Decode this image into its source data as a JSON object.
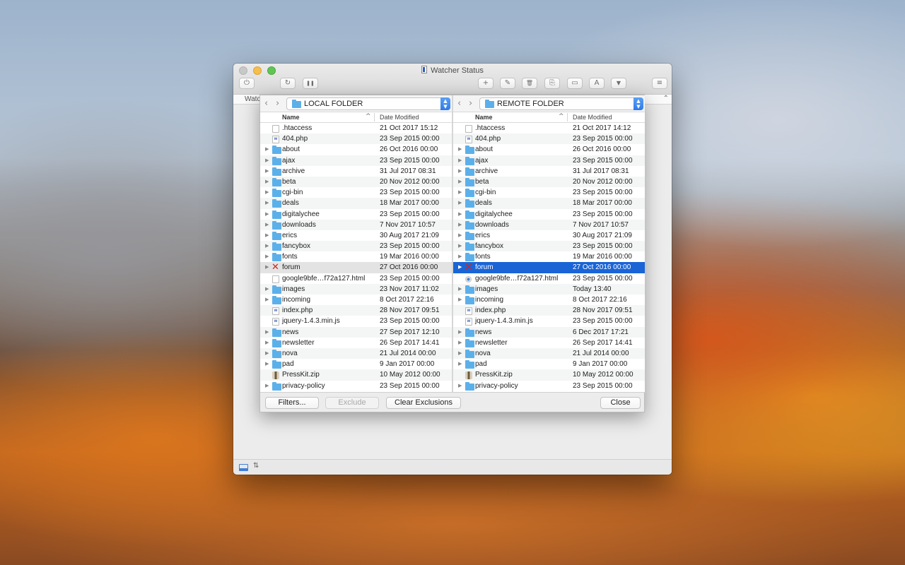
{
  "window": {
    "title": "Watcher Status",
    "tab_peek": "Watc"
  },
  "toolbar": {
    "power_glyph": "⏻",
    "refresh_glyph": "↻",
    "pause_glyph": "❚❚",
    "new_file_glyph": "+",
    "edit_glyph": "✎",
    "trash_glyph": "🗑",
    "copy_glyph": "⎘",
    "folder_glyph": "▭",
    "rename_glyph": "A",
    "filter_glyph": "▼",
    "log_glyph": "≡"
  },
  "local": {
    "path": "LOCAL FOLDER",
    "col_name": "Name",
    "col_date": "Date Modified",
    "rows": [
      {
        "name": ".htaccess",
        "date": "21 Oct 2017 15:12",
        "icon": "file-icon",
        "tri": ""
      },
      {
        "name": "404.php",
        "date": "23 Sep 2015 00:00",
        "icon": "php-file-icon",
        "tri": ""
      },
      {
        "name": "about",
        "date": "26 Oct 2016 00:00",
        "icon": "folder-icon",
        "tri": "▶"
      },
      {
        "name": "ajax",
        "date": "23 Sep 2015 00:00",
        "icon": "folder-icon",
        "tri": "▶"
      },
      {
        "name": "archive",
        "date": "31 Jul 2017 08:31",
        "icon": "folder-icon",
        "tri": "▶"
      },
      {
        "name": "beta",
        "date": "20 Nov 2012 00:00",
        "icon": "folder-icon",
        "tri": "▶"
      },
      {
        "name": "cgi-bin",
        "date": "23 Sep 2015 00:00",
        "icon": "folder-icon",
        "tri": "▶"
      },
      {
        "name": "deals",
        "date": "18 Mar 2017 00:00",
        "icon": "folder-icon",
        "tri": "▶"
      },
      {
        "name": "digitalychee",
        "date": "23 Sep 2015 00:00",
        "icon": "folder-icon",
        "tri": "▶"
      },
      {
        "name": "downloads",
        "date": "7 Nov 2017 10:57",
        "icon": "folder-icon",
        "tri": "▶"
      },
      {
        "name": "erics",
        "date": "30 Aug 2017 21:09",
        "icon": "folder-icon",
        "tri": "▶"
      },
      {
        "name": "fancybox",
        "date": "23 Sep 2015 00:00",
        "icon": "folder-icon",
        "tri": "▶"
      },
      {
        "name": "fonts",
        "date": "19 Mar 2016 00:00",
        "icon": "folder-icon",
        "tri": "▶"
      },
      {
        "name": "forum",
        "date": "27 Oct 2016 00:00",
        "icon": "excluded-x-icon",
        "tri": "▶",
        "state": "dim"
      },
      {
        "name": "google9bfe…f72a127.html",
        "date": "23 Sep 2015 00:00",
        "icon": "file-icon",
        "tri": ""
      },
      {
        "name": "images",
        "date": "23 Nov 2017 11:02",
        "icon": "folder-icon",
        "tri": "▶"
      },
      {
        "name": "incoming",
        "date": "8 Oct 2017 22:16",
        "icon": "folder-icon",
        "tri": "▶"
      },
      {
        "name": "index.php",
        "date": "28 Nov 2017 09:51",
        "icon": "php-file-icon",
        "tri": ""
      },
      {
        "name": "jquery-1.4.3.min.js",
        "date": "23 Sep 2015 00:00",
        "icon": "php-file-icon",
        "tri": ""
      },
      {
        "name": "news",
        "date": "27 Sep 2017 12:10",
        "icon": "folder-icon",
        "tri": "▶"
      },
      {
        "name": "newsletter",
        "date": "26 Sep 2017 14:41",
        "icon": "folder-icon",
        "tri": "▶"
      },
      {
        "name": "nova",
        "date": "21 Jul 2014 00:00",
        "icon": "folder-icon",
        "tri": "▶"
      },
      {
        "name": "pad",
        "date": "9 Jan 2017 00:00",
        "icon": "folder-icon",
        "tri": "▶"
      },
      {
        "name": "PressKit.zip",
        "date": "10 May 2012 00:00",
        "icon": "zip-icon",
        "tri": ""
      },
      {
        "name": "privacy-policy",
        "date": "23 Sep 2015 00:00",
        "icon": "folder-icon",
        "tri": "▶"
      }
    ]
  },
  "remote": {
    "path": "REMOTE FOLDER",
    "col_name": "Name",
    "col_date": "Date Modified",
    "rows": [
      {
        "name": ".htaccess",
        "date": "21 Oct 2017 14:12",
        "icon": "file-icon",
        "tri": ""
      },
      {
        "name": "404.php",
        "date": "23 Sep 2015 00:00",
        "icon": "php-file-icon",
        "tri": ""
      },
      {
        "name": "about",
        "date": "26 Oct 2016 00:00",
        "icon": "folder-icon",
        "tri": "▶"
      },
      {
        "name": "ajax",
        "date": "23 Sep 2015 00:00",
        "icon": "folder-icon",
        "tri": "▶"
      },
      {
        "name": "archive",
        "date": "31 Jul 2017 08:31",
        "icon": "folder-icon",
        "tri": "▶"
      },
      {
        "name": "beta",
        "date": "20 Nov 2012 00:00",
        "icon": "folder-icon",
        "tri": "▶"
      },
      {
        "name": "cgi-bin",
        "date": "23 Sep 2015 00:00",
        "icon": "folder-icon",
        "tri": "▶"
      },
      {
        "name": "deals",
        "date": "18 Mar 2017 00:00",
        "icon": "folder-icon",
        "tri": "▶"
      },
      {
        "name": "digitalychee",
        "date": "23 Sep 2015 00:00",
        "icon": "folder-icon",
        "tri": "▶"
      },
      {
        "name": "downloads",
        "date": "7 Nov 2017 10:57",
        "icon": "folder-icon",
        "tri": "▶"
      },
      {
        "name": "erics",
        "date": "30 Aug 2017 21:09",
        "icon": "folder-icon",
        "tri": "▶"
      },
      {
        "name": "fancybox",
        "date": "23 Sep 2015 00:00",
        "icon": "folder-icon",
        "tri": "▶"
      },
      {
        "name": "fonts",
        "date": "19 Mar 2016 00:00",
        "icon": "folder-icon",
        "tri": "▶"
      },
      {
        "name": "forum",
        "date": "27 Oct 2016 00:00",
        "icon": "excluded-x-icon",
        "tri": "▶",
        "state": "sel"
      },
      {
        "name": "google9bfe…f72a127.html",
        "date": "23 Sep 2015 00:00",
        "icon": "html-dot-icon",
        "tri": ""
      },
      {
        "name": "images",
        "date": "Today 13:40",
        "icon": "folder-icon",
        "tri": "▶"
      },
      {
        "name": "incoming",
        "date": "8 Oct 2017 22:16",
        "icon": "folder-icon",
        "tri": "▶"
      },
      {
        "name": "index.php",
        "date": "28 Nov 2017 09:51",
        "icon": "php-file-icon",
        "tri": ""
      },
      {
        "name": "jquery-1.4.3.min.js",
        "date": "23 Sep 2015 00:00",
        "icon": "php-file-icon",
        "tri": ""
      },
      {
        "name": "news",
        "date": "6 Dec 2017 17:21",
        "icon": "folder-icon",
        "tri": "▶"
      },
      {
        "name": "newsletter",
        "date": "26 Sep 2017 14:41",
        "icon": "folder-icon",
        "tri": "▶"
      },
      {
        "name": "nova",
        "date": "21 Jul 2014 00:00",
        "icon": "folder-icon",
        "tri": "▶"
      },
      {
        "name": "pad",
        "date": "9 Jan 2017 00:00",
        "icon": "folder-icon",
        "tri": "▶"
      },
      {
        "name": "PressKit.zip",
        "date": "10 May 2012 00:00",
        "icon": "zip-icon",
        "tri": ""
      },
      {
        "name": "privacy-policy",
        "date": "23 Sep 2015 00:00",
        "icon": "folder-icon",
        "tri": "▶"
      }
    ]
  },
  "buttons": {
    "filters": "Filters...",
    "exclude": "Exclude",
    "clear_exclusions": "Clear Exclusions",
    "close": "Close"
  },
  "colors": {
    "selection": "#1a64d6",
    "folder": "#5cb0ea",
    "excluded": "#d3231c"
  }
}
